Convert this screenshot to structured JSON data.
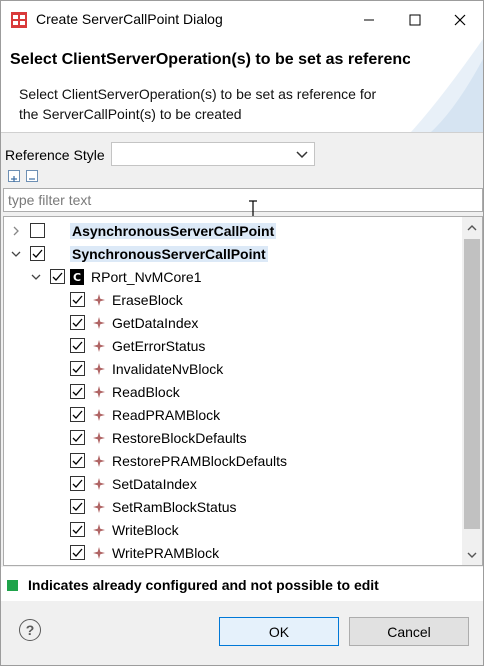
{
  "window": {
    "title": "Create ServerCallPoint Dialog"
  },
  "banner": {
    "title": "Select ClientServerOperation(s) to be set as reference",
    "description": "Select ClientServerOperation(s) to be set as reference for the ServerCallPoint(s) to be created"
  },
  "reference": {
    "label": "Reference Style",
    "value": ""
  },
  "filter": {
    "placeholder": "type filter text"
  },
  "tree": {
    "async": {
      "label": "AsynchronousServerCallPoint",
      "checked": false,
      "expanded": false
    },
    "sync": {
      "label": "SynchronousServerCallPoint",
      "checked": true,
      "expanded": true
    },
    "port": {
      "label": "RPort_NvMCore1",
      "checked": true,
      "icon": "C"
    },
    "operations": [
      {
        "label": "EraseBlock",
        "checked": true
      },
      {
        "label": "GetDataIndex",
        "checked": true
      },
      {
        "label": "GetErrorStatus",
        "checked": true
      },
      {
        "label": "InvalidateNvBlock",
        "checked": true
      },
      {
        "label": "ReadBlock",
        "checked": true
      },
      {
        "label": "ReadPRAMBlock",
        "checked": true
      },
      {
        "label": "RestoreBlockDefaults",
        "checked": true
      },
      {
        "label": "RestorePRAMBlockDefaults",
        "checked": true
      },
      {
        "label": "SetDataIndex",
        "checked": true
      },
      {
        "label": "SetRamBlockStatus",
        "checked": true
      },
      {
        "label": "WriteBlock",
        "checked": true
      },
      {
        "label": "WritePRAMBlock",
        "checked": true
      }
    ]
  },
  "legend": {
    "text": "Indicates already configured and not possible to edit",
    "color": "#1fa34a"
  },
  "buttons": {
    "help": "?",
    "ok": "OK",
    "cancel": "Cancel"
  },
  "icons": {
    "app": "app-icon",
    "minimize": "minimize-icon",
    "maximize": "maximize-icon",
    "close": "close-icon",
    "expand_all": "expand-all-icon",
    "collapse_all": "collapse-all-icon",
    "operation": "operation-icon",
    "port": "port-icon"
  }
}
